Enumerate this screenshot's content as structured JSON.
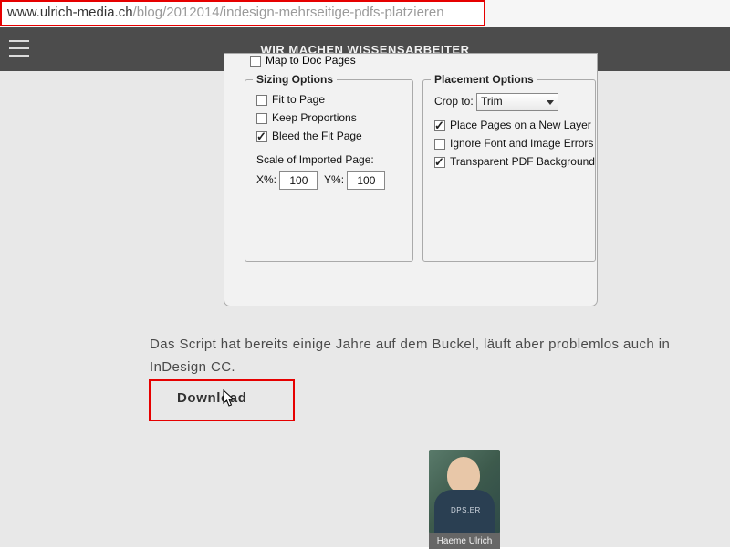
{
  "url": {
    "host": "www.ulrich-media.ch",
    "path": "/blog/2012014/indesign-mehrseitige-pdfs-platzieren"
  },
  "topnav": {
    "site_title": "WIR MACHEN WISSENSARBEITER"
  },
  "dialog": {
    "map_to_doc": "Map to Doc Pages",
    "sizing": {
      "legend": "Sizing Options",
      "fit_to_page": "Fit to Page",
      "keep_proportions": "Keep Proportions",
      "bleed_fit": "Bleed the Fit Page",
      "scale_label": "Scale of Imported Page:",
      "x_label": "X%:",
      "x_val": "100",
      "y_label": "Y%:",
      "y_val": "100"
    },
    "placement": {
      "legend": "Placement Options",
      "crop_label": "Crop to:",
      "crop_value": "Trim",
      "new_layer": "Place Pages on a New Layer",
      "ignore_font": "Ignore Font and Image Errors",
      "transparent": "Transparent PDF Background"
    }
  },
  "article": {
    "paragraph": "Das Script hat bereits einige Jahre auf dem Buckel, läuft aber problemlos auch in InDesign CC.",
    "download": "Download"
  },
  "author": {
    "name": "Haeme Ulrich",
    "shirt": "DPS.ER"
  }
}
